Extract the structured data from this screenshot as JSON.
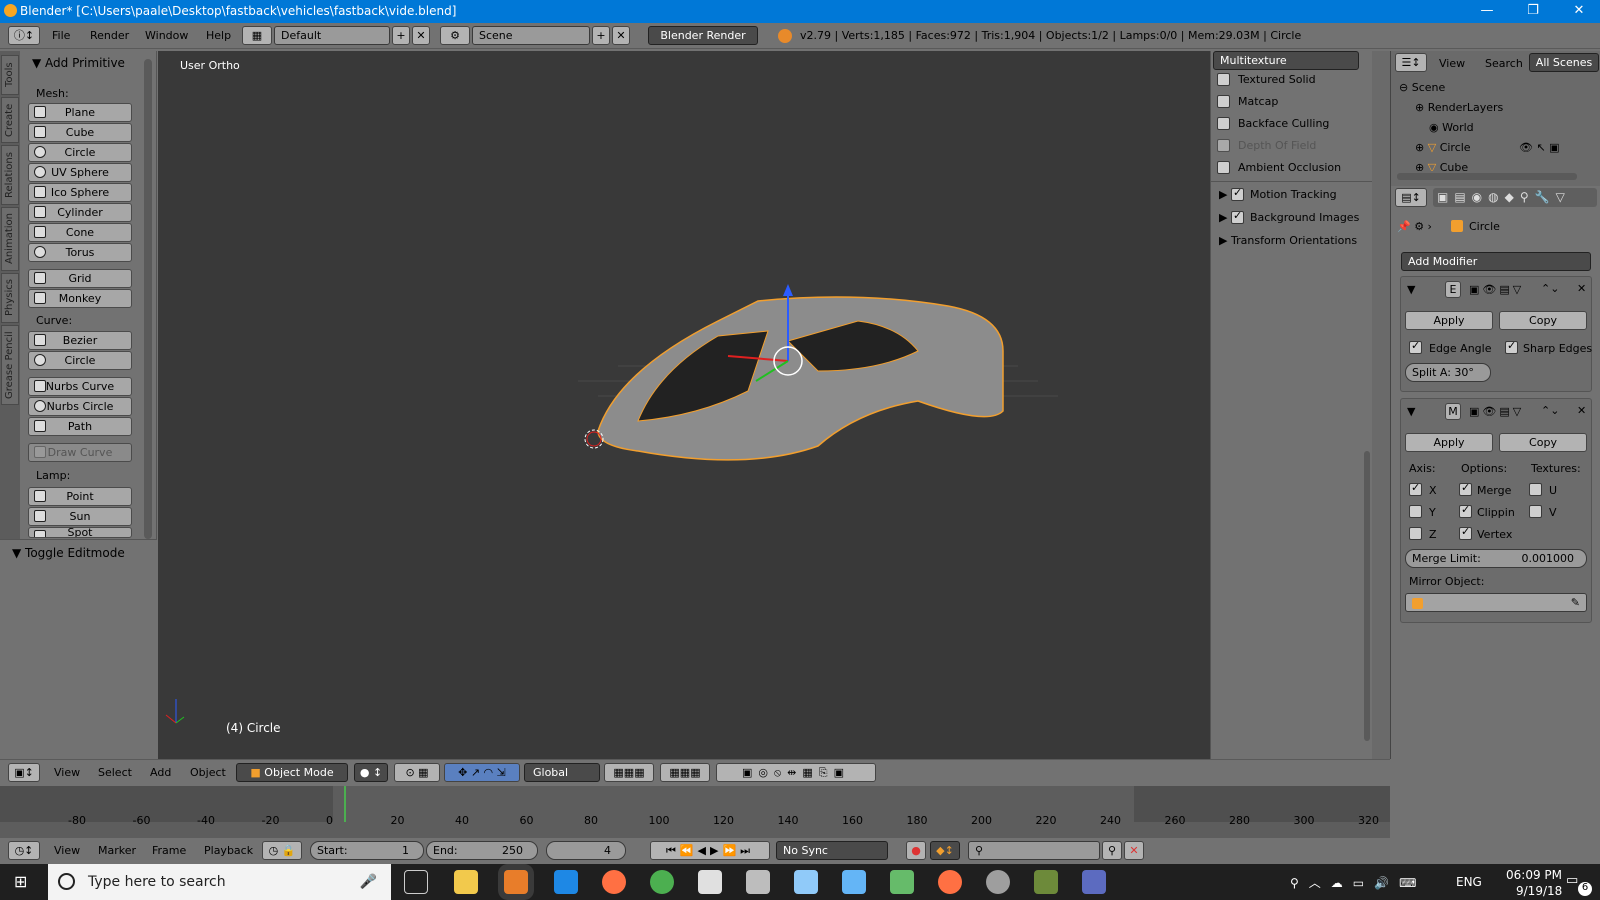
{
  "window": {
    "title": "Blender* [C:\\Users\\paale\\Desktop\\fastback\\vehicles\\fastback\\vide.blend]",
    "minimize": "—",
    "restore": "❐",
    "close": "✕"
  },
  "infobar": {
    "menus": [
      "File",
      "Render",
      "Window",
      "Help"
    ],
    "layout": "Default",
    "scene": "Scene",
    "engine": "Blender Render",
    "stats": "v2.79 | Verts:1,185 | Faces:972 | Tris:1,904 | Objects:1/2 | Lamps:0/0 | Mem:29.03M | Circle"
  },
  "tabs": [
    "Tools",
    "Create",
    "Relations",
    "Animation",
    "Physics",
    "Grease Pencil"
  ],
  "toolshelf": {
    "panel": "Add Primitive",
    "mesh_label": "Mesh:",
    "mesh": [
      "Plane",
      "Cube",
      "Circle",
      "UV Sphere",
      "Ico Sphere",
      "Cylinder",
      "Cone",
      "Torus",
      "Grid",
      "Monkey"
    ],
    "curve_label": "Curve:",
    "curve": [
      "Bezier",
      "Circle",
      "Nurbs Curve",
      "Nurbs Circle",
      "Path",
      "Draw Curve"
    ],
    "lamp_label": "Lamp:",
    "lamp": [
      "Point",
      "Sun",
      "Spot"
    ],
    "toggle": "Toggle Editmode"
  },
  "viewport": {
    "view_label": "User Ortho",
    "object_label": "(4) Circle"
  },
  "npanel": {
    "shading": "Multitexture",
    "options": [
      {
        "label": "Textured Solid",
        "checked": false
      },
      {
        "label": "Matcap",
        "checked": false
      },
      {
        "label": "Backface Culling",
        "checked": false
      },
      {
        "label": "Depth Of Field",
        "checked": false
      },
      {
        "label": "Ambient Occlusion",
        "checked": false
      }
    ],
    "sections": [
      {
        "label": "Motion Tracking",
        "checked": true
      },
      {
        "label": "Background Images",
        "checked": true
      },
      {
        "label": "Transform Orientations"
      }
    ]
  },
  "outliner": {
    "menus": [
      "View",
      "Search"
    ],
    "filter": "All Scenes",
    "items": [
      "Scene",
      "RenderLayers",
      "World",
      "Circle",
      "Cube"
    ]
  },
  "props": {
    "object": "Circle",
    "add_modifier": "Add Modifier",
    "mod1": {
      "code": "E",
      "apply": "Apply",
      "copy": "Copy",
      "edge_angle": "Edge Angle",
      "sharp_edges": "Sharp Edges",
      "split": "Split A: 30°"
    },
    "mod2": {
      "code": "M",
      "apply": "Apply",
      "copy": "Copy",
      "axis_label": "Axis:",
      "options_label": "Options:",
      "textures_label": "Textures:",
      "x": "X",
      "y": "Y",
      "z": "Z",
      "merge": "Merge",
      "clipping": "Clippin",
      "vertex": "Vertex",
      "u": "U",
      "v": "V",
      "merge_limit_label": "Merge Limit:",
      "merge_limit": "0.001000",
      "mirror_object": "Mirror Object:"
    }
  },
  "vp_header": {
    "menus": [
      "View",
      "Select",
      "Add",
      "Object"
    ],
    "mode": "Object Mode",
    "orientation": "Global"
  },
  "timeline": {
    "ticks": [
      "-80",
      "-60",
      "-40",
      "-20",
      "0",
      "20",
      "40",
      "60",
      "80",
      "100",
      "120",
      "140",
      "160",
      "180",
      "200",
      "220",
      "240",
      "260",
      "280",
      "300",
      "320"
    ],
    "menus": [
      "View",
      "Marker",
      "Frame",
      "Playback"
    ],
    "start": "Start:",
    "start_val": "1",
    "end": "End:",
    "end_val": "250",
    "current": "4",
    "sync": "No Sync"
  },
  "taskbar": {
    "search": "Type here to search",
    "lang": "ENG",
    "time": "06:09 PM",
    "date": "9/19/18",
    "notif": "6"
  }
}
